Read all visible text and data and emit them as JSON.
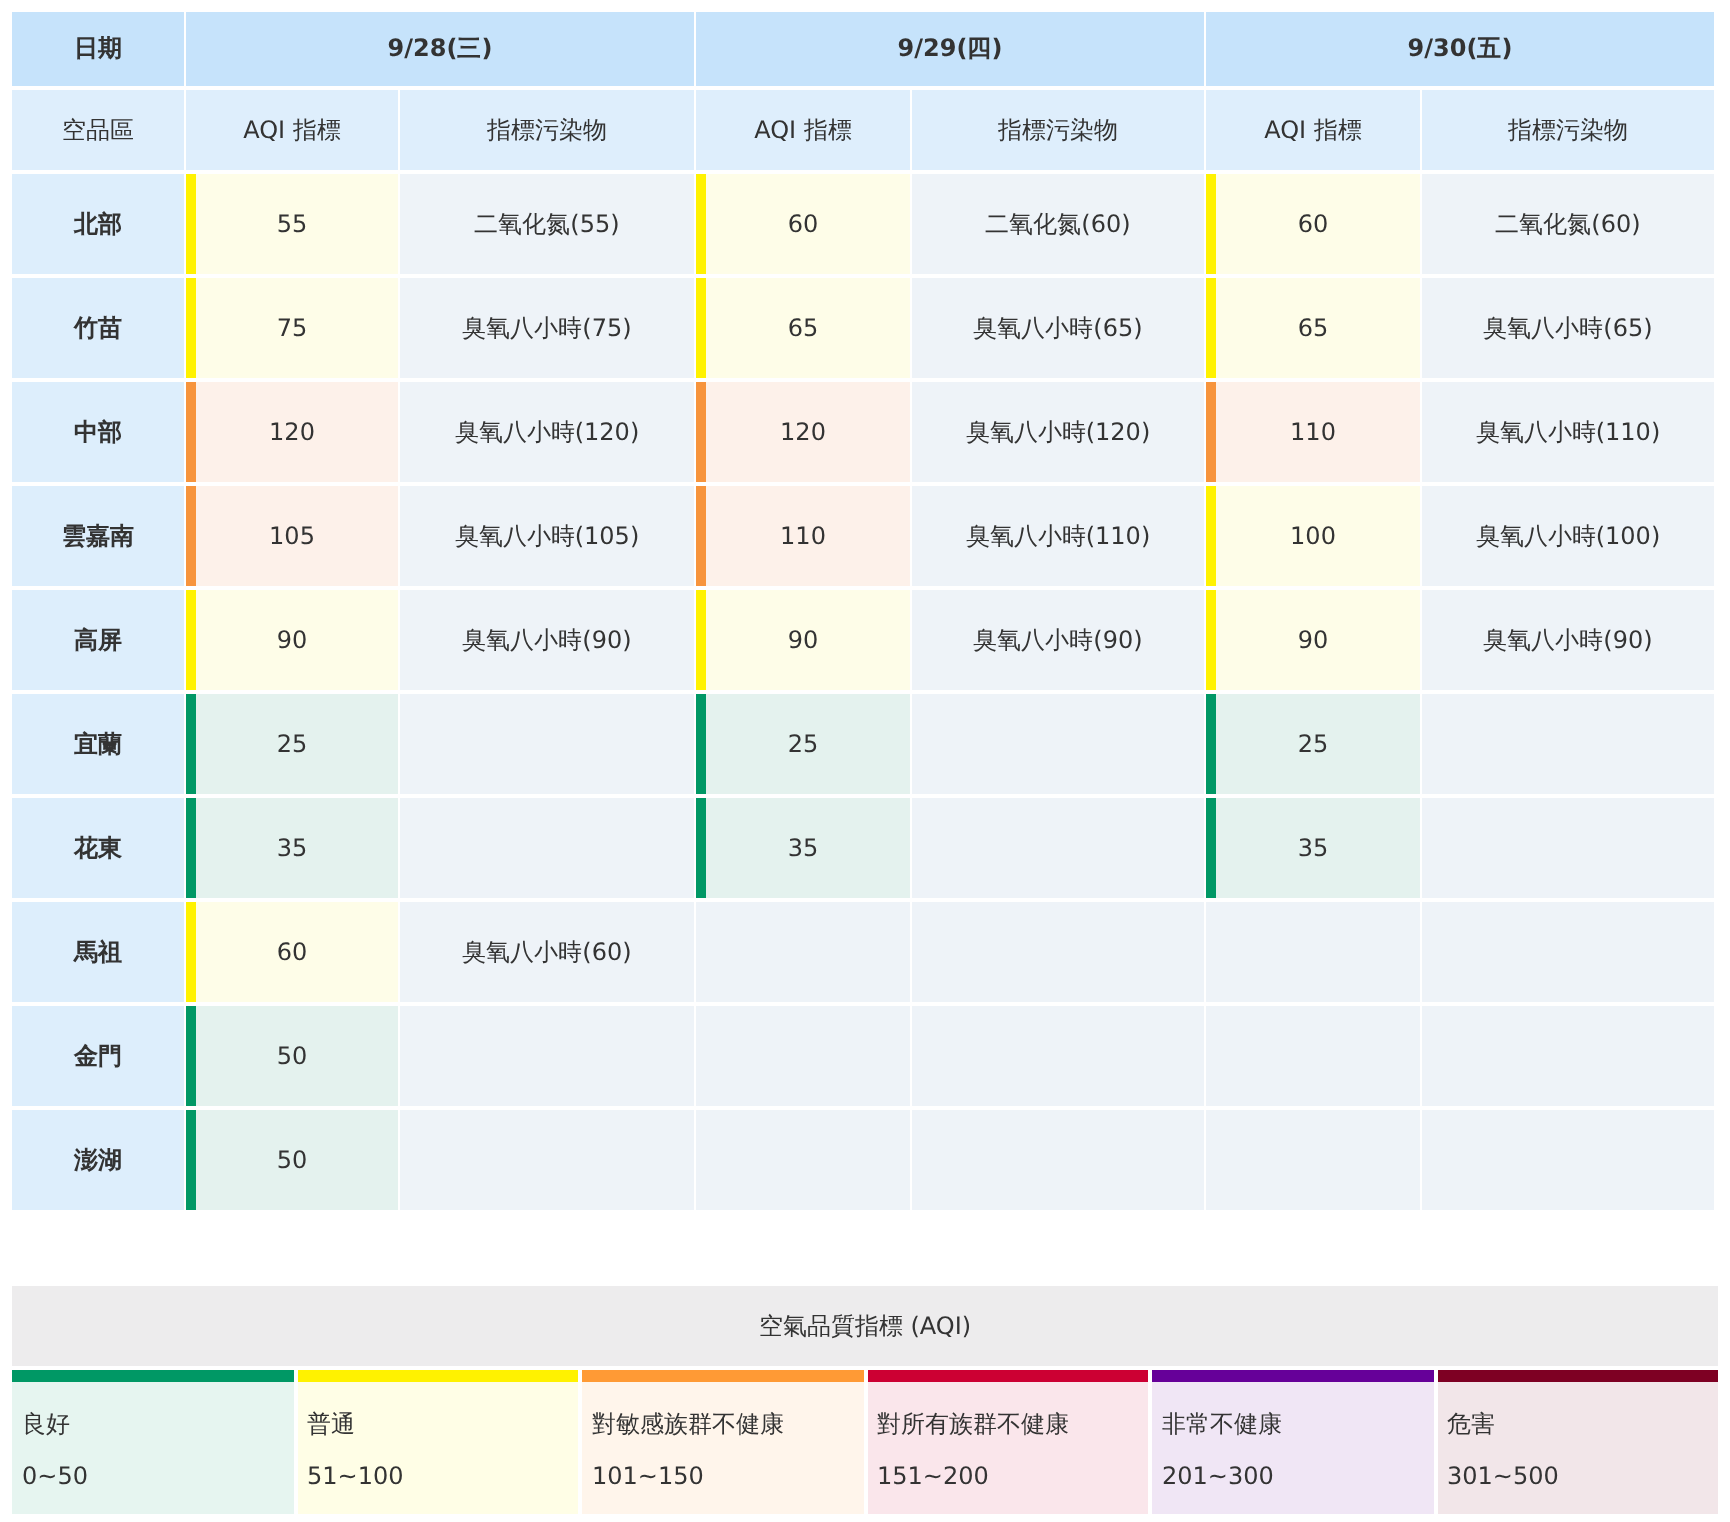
{
  "table": {
    "date_label": "日期",
    "region_label": "空品區",
    "days": [
      {
        "date": "9/28(三)",
        "aqi_label": "AQI 指標",
        "pollutant_label": "指標污染物"
      },
      {
        "date": "9/29(四)",
        "aqi_label": "AQI 指標",
        "pollutant_label": "指標污染物"
      },
      {
        "date": "9/30(五)",
        "aqi_label": "AQI 指標",
        "pollutant_label": "指標污染物"
      }
    ],
    "rows": [
      {
        "region": "北部",
        "cells": [
          {
            "kind": "moderate",
            "aqi": "55",
            "pollutant": "二氧化氮(55)"
          },
          {
            "kind": "moderate",
            "aqi": "60",
            "pollutant": "二氧化氮(60)"
          },
          {
            "kind": "moderate",
            "aqi": "60",
            "pollutant": "二氧化氮(60)"
          }
        ]
      },
      {
        "region": "竹苗",
        "cells": [
          {
            "kind": "moderate",
            "aqi": "75",
            "pollutant": "臭氧八小時(75)"
          },
          {
            "kind": "moderate",
            "aqi": "65",
            "pollutant": "臭氧八小時(65)"
          },
          {
            "kind": "moderate",
            "aqi": "65",
            "pollutant": "臭氧八小時(65)"
          }
        ]
      },
      {
        "region": "中部",
        "cells": [
          {
            "kind": "sensitive",
            "aqi": "120",
            "pollutant": "臭氧八小時(120)"
          },
          {
            "kind": "sensitive",
            "aqi": "120",
            "pollutant": "臭氧八小時(120)"
          },
          {
            "kind": "sensitive",
            "aqi": "110",
            "pollutant": "臭氧八小時(110)"
          }
        ]
      },
      {
        "region": "雲嘉南",
        "cells": [
          {
            "kind": "sensitive",
            "aqi": "105",
            "pollutant": "臭氧八小時(105)"
          },
          {
            "kind": "sensitive",
            "aqi": "110",
            "pollutant": "臭氧八小時(110)"
          },
          {
            "kind": "moderate",
            "aqi": "100",
            "pollutant": "臭氧八小時(100)"
          }
        ]
      },
      {
        "region": "高屏",
        "cells": [
          {
            "kind": "moderate",
            "aqi": "90",
            "pollutant": "臭氧八小時(90)"
          },
          {
            "kind": "moderate",
            "aqi": "90",
            "pollutant": "臭氧八小時(90)"
          },
          {
            "kind": "moderate",
            "aqi": "90",
            "pollutant": "臭氧八小時(90)"
          }
        ]
      },
      {
        "region": "宜蘭",
        "cells": [
          {
            "kind": "good",
            "aqi": "25"
          },
          {
            "kind": "good",
            "aqi": "25"
          },
          {
            "kind": "good",
            "aqi": "25"
          }
        ]
      },
      {
        "region": "花東",
        "cells": [
          {
            "kind": "good",
            "aqi": "35"
          },
          {
            "kind": "good",
            "aqi": "35"
          },
          {
            "kind": "good",
            "aqi": "35"
          }
        ]
      },
      {
        "region": "馬祖",
        "cells": [
          {
            "kind": "moderate",
            "aqi": "60",
            "pollutant": "臭氧八小時(60)"
          },
          null,
          null
        ]
      },
      {
        "region": "金門",
        "cells": [
          {
            "kind": "good",
            "aqi": "50"
          },
          null,
          null
        ]
      },
      {
        "region": "澎湖",
        "cells": [
          {
            "kind": "good",
            "aqi": "50"
          },
          null,
          null
        ]
      }
    ]
  },
  "legend": {
    "title": "空氣品質指標 (AQI)",
    "items": [
      {
        "label": "良好",
        "range": "0~50",
        "color": "#009865"
      },
      {
        "label": "普通",
        "range": "51~100",
        "color": "#fff200"
      },
      {
        "label": "對敏感族群不健康",
        "range": "101~150",
        "color": "#ff9a35"
      },
      {
        "label": "對所有族群不健康",
        "range": "151~200",
        "color": "#cc0033"
      },
      {
        "label": "非常不健康",
        "range": "201~300",
        "color": "#660099"
      },
      {
        "label": "危害",
        "range": "301~500",
        "color": "#7e0023"
      }
    ]
  }
}
